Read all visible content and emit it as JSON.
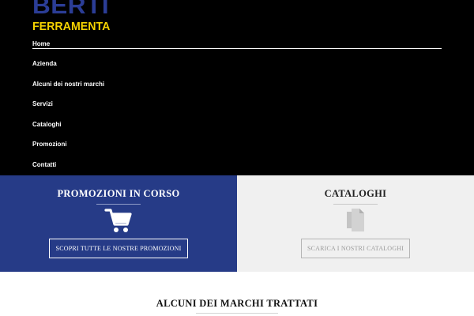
{
  "logo": {
    "line1": "BERTI",
    "line2": "FERRAMENTA",
    "primary_color": "#2b3d96",
    "accent_color": "#f5d200"
  },
  "nav": {
    "items": [
      {
        "label": "Home"
      },
      {
        "label": "Azienda"
      },
      {
        "label": "Alcuni dei nostri marchi"
      },
      {
        "label": "Servizi"
      },
      {
        "label": "Cataloghi"
      },
      {
        "label": "Promozioni"
      },
      {
        "label": "Contatti"
      }
    ]
  },
  "promo": {
    "title": "PROMOZIONI IN CORSO",
    "icon": "shopping-cart-icon",
    "button_label": "SCOPRI TUTTE LE NOSTRE PROMOZIONI",
    "background": "#263b87"
  },
  "catalog": {
    "title": "CATALOGHI",
    "icon": "documents-icon",
    "button_label": "SCARICA I NOSTRI CATALOGHI",
    "background": "#f0f0f0"
  },
  "brands": {
    "title": "ALCUNI DEI MARCHI TRATTATI"
  }
}
